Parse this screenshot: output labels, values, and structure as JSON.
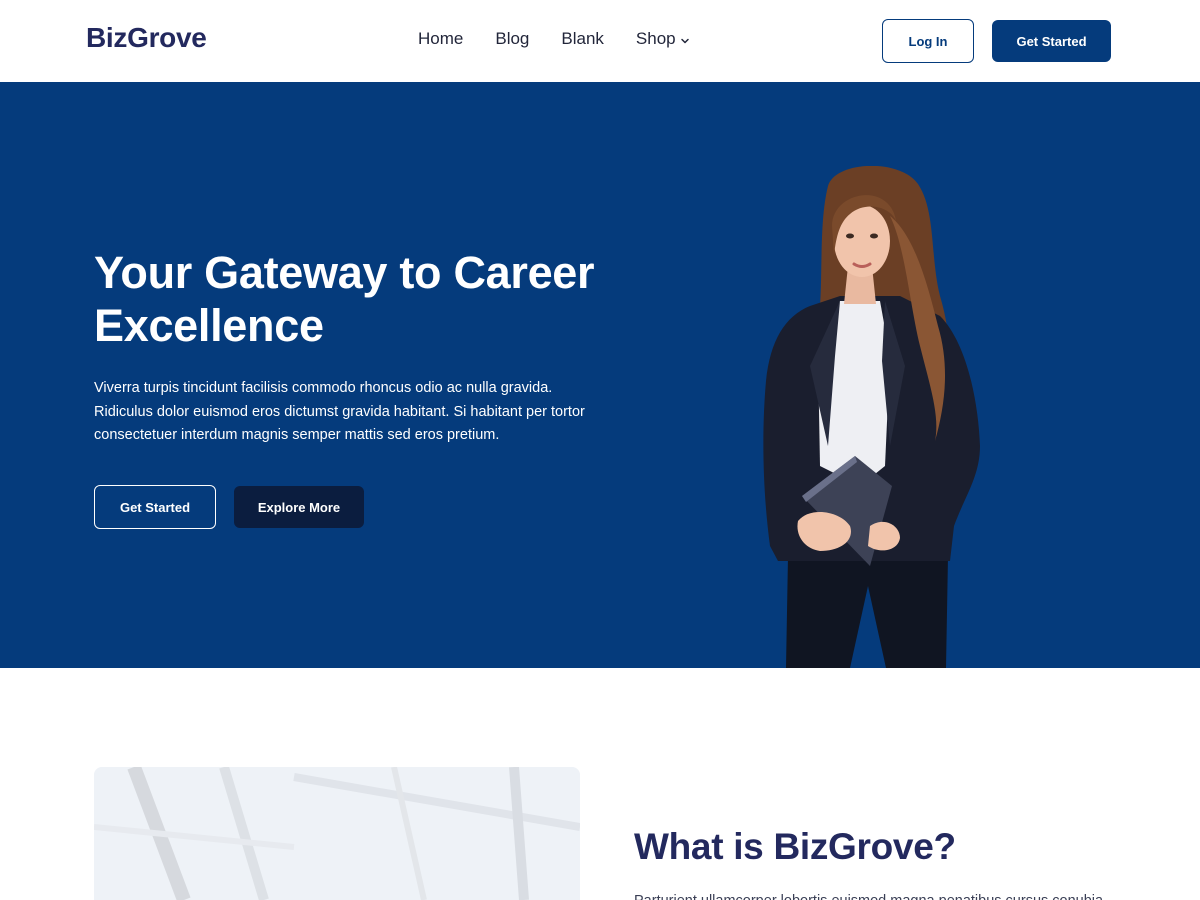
{
  "header": {
    "logo": "BizGrove",
    "nav": [
      {
        "label": "Home"
      },
      {
        "label": "Blog"
      },
      {
        "label": "Blank"
      },
      {
        "label": "Shop",
        "has_dropdown": true
      }
    ],
    "login_label": "Log In",
    "cta_label": "Get Started"
  },
  "hero": {
    "title": "Your Gateway to Career Excellence",
    "text": "Viverra turpis tincidunt facilisis commodo rhoncus odio ac nulla gravida. Ridiculus dolor euismod eros dictumst gravida habitant. Si habitant per tortor consectetuer interdum magnis semper mattis sed eros pretium.",
    "primary_button": "Get Started",
    "secondary_button": "Explore More",
    "image": "businesswoman-holding-notebook"
  },
  "about": {
    "title": "What is BizGrove?",
    "text": "Parturient ullamcorper lobortis euismod magna penatibus cursus conubia nascetur natoque ipsum",
    "image": "glass-building-ceiling"
  },
  "colors": {
    "brand": "#053b7c",
    "logo": "#23295e",
    "dark_button": "#0b1d3f"
  }
}
